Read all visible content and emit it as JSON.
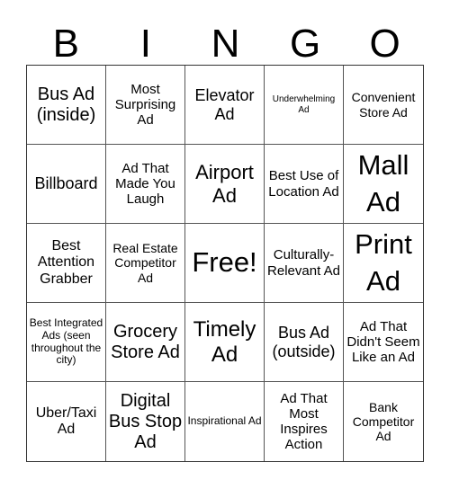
{
  "header": {
    "letters": [
      "B",
      "I",
      "N",
      "G",
      "O"
    ]
  },
  "cells": [
    "Bus Ad (inside)",
    "Most Surprising Ad",
    "Elevator Ad",
    "Underwhelming Ad",
    "Convenient Store Ad",
    "Billboard",
    "Ad That Made You Laugh",
    "Airport Ad",
    "Best Use of Location Ad",
    "Mall Ad",
    "Best Attention Grabber",
    "Real Estate Competitor Ad",
    "Free!",
    "Culturally-Relevant Ad",
    "Print Ad",
    "Best Integrated Ads (seen throughout the city)",
    "Grocery Store Ad",
    "Timely Ad",
    "Bus Ad (outside)",
    "Ad That Didn't Seem Like an Ad",
    "Uber/Taxi Ad",
    "Digital Bus Stop Ad",
    "Inspirational Ad",
    "Ad That Most Inspires Action",
    "Bank Competitor Ad"
  ]
}
